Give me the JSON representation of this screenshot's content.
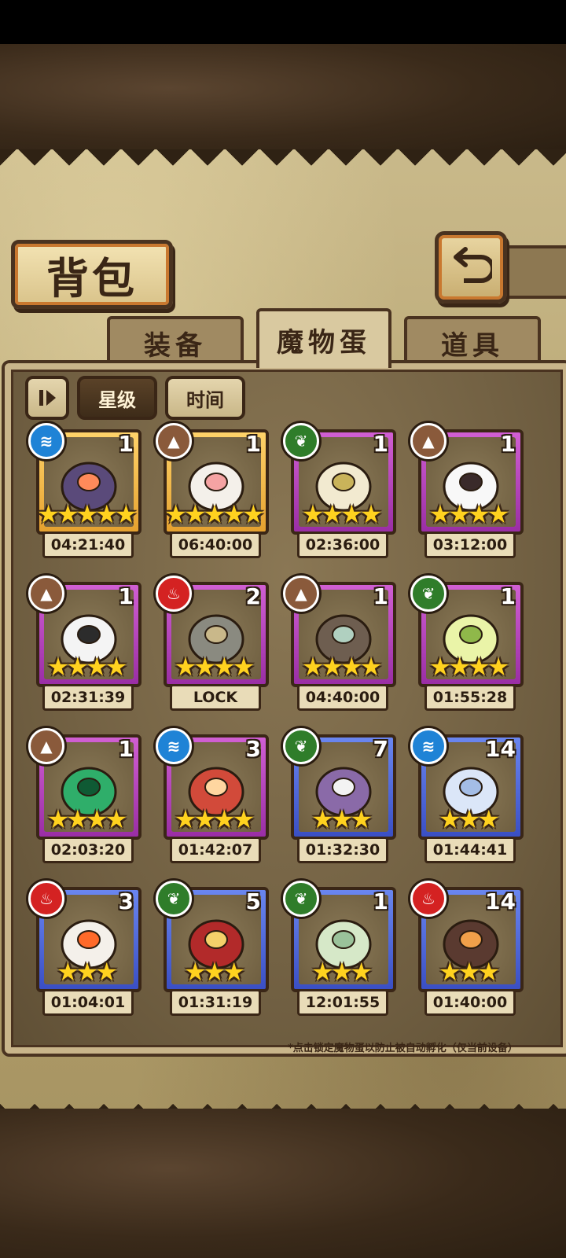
{
  "title": "背包",
  "tabs": [
    {
      "label": "装备"
    },
    {
      "label": "魔物蛋"
    },
    {
      "label": "道具"
    }
  ],
  "sort": {
    "toggle_icon": "pause-sort-icon",
    "options": [
      {
        "label": "星级"
      },
      {
        "label": "时间"
      }
    ]
  },
  "eggs": [
    {
      "element": "water",
      "count": "1",
      "stars": 5,
      "frame": "gold",
      "timer": "04:21:40"
    },
    {
      "element": "earth",
      "count": "1",
      "stars": 5,
      "frame": "gold",
      "timer": "06:40:00"
    },
    {
      "element": "leaf",
      "count": "1",
      "stars": 4,
      "frame": "purple",
      "timer": "02:36:00"
    },
    {
      "element": "earth",
      "count": "1",
      "stars": 4,
      "frame": "purple",
      "timer": "03:12:00"
    },
    {
      "element": "earth",
      "count": "1",
      "stars": 4,
      "frame": "purple",
      "timer": "02:31:39"
    },
    {
      "element": "fire",
      "count": "2",
      "stars": 4,
      "frame": "purple",
      "timer": "LOCK"
    },
    {
      "element": "earth",
      "count": "1",
      "stars": 4,
      "frame": "purple",
      "timer": "04:40:00"
    },
    {
      "element": "leaf",
      "count": "1",
      "stars": 4,
      "frame": "purple",
      "timer": "01:55:28"
    },
    {
      "element": "earth",
      "count": "1",
      "stars": 4,
      "frame": "purple",
      "timer": "02:03:20"
    },
    {
      "element": "water",
      "count": "3",
      "stars": 4,
      "frame": "purple",
      "timer": "01:42:07"
    },
    {
      "element": "leaf",
      "count": "7",
      "stars": 3,
      "frame": "blue",
      "timer": "01:32:30"
    },
    {
      "element": "water",
      "count": "14",
      "stars": 3,
      "frame": "blue",
      "timer": "01:44:41"
    },
    {
      "element": "fire",
      "count": "3",
      "stars": 3,
      "frame": "blue",
      "timer": "01:04:01"
    },
    {
      "element": "leaf",
      "count": "5",
      "stars": 3,
      "frame": "blue",
      "timer": "01:31:19"
    },
    {
      "element": "leaf",
      "count": "1",
      "stars": 3,
      "frame": "blue",
      "timer": "12:01:55"
    },
    {
      "element": "fire",
      "count": "14",
      "stars": 3,
      "frame": "blue",
      "timer": "01:40:00"
    }
  ],
  "footer_note": "*点击锁定魔物蛋以防止被自动孵化（仅当前设备）",
  "colors": {
    "gold_frame": "#e5a12f",
    "purple_frame": "#9a2ea5",
    "blue_frame": "#3a4fc4",
    "star": "#ffd21f",
    "water": "#1f83d6",
    "earth": "#8a5a3b",
    "leaf": "#2f7d2a",
    "fire": "#d42222"
  }
}
